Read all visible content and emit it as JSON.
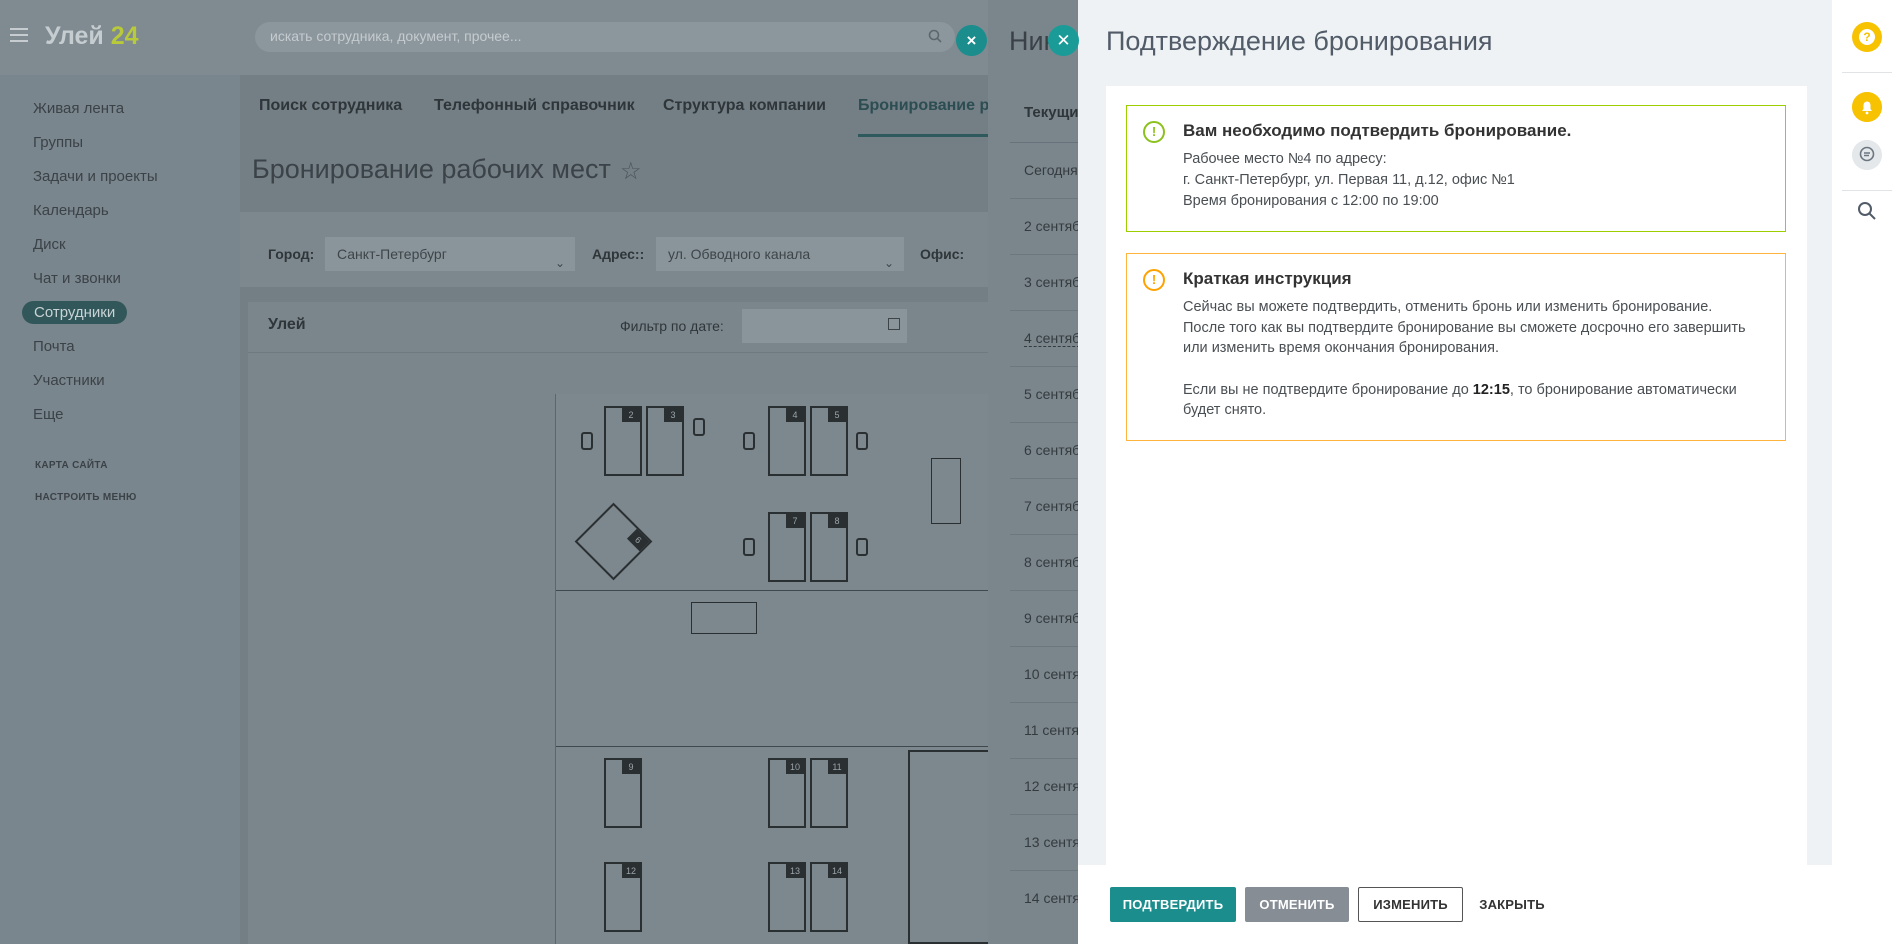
{
  "app": {
    "logo_text": "Улей",
    "logo_num": "24"
  },
  "search": {
    "placeholder": "искать сотрудника, документ, прочее..."
  },
  "sidebar": {
    "items": [
      {
        "label": "Живая лента"
      },
      {
        "label": "Группы"
      },
      {
        "label": "Задачи и проекты"
      },
      {
        "label": "Календарь"
      },
      {
        "label": "Диск"
      },
      {
        "label": "Чат и звонки"
      },
      {
        "label": "Сотрудники"
      },
      {
        "label": "Почта"
      },
      {
        "label": "Участники"
      },
      {
        "label": "Еще"
      }
    ],
    "active": "Сотрудники",
    "small_links": [
      "КАРТА САЙТА",
      "НАСТРОИТЬ МЕНЮ"
    ]
  },
  "main": {
    "tabs": [
      "Поиск сотрудника",
      "Телефонный справочник",
      "Структура компании",
      "Бронирование ра"
    ],
    "page_title": "Бронирование рабочих мест",
    "filters": {
      "city_label": "Город:",
      "city_value": "Санкт-Петербург",
      "address_label": "Адрес::",
      "address_value": "ул. Обводного канала",
      "office_label": "Офис:"
    },
    "card_title": "Улей",
    "date_filter_label": "Фильтр по дате:",
    "seat_numbers": [
      "2",
      "3",
      "4",
      "5",
      "6",
      "7",
      "8",
      "9",
      "10",
      "11",
      "12",
      "13",
      "14"
    ]
  },
  "side_panel": {
    "title": "Ник",
    "tab": "Текущи",
    "dates": [
      "Сегодня",
      "2 сентяб",
      "3 сентяб",
      "4 сентяб",
      "5 сентяб",
      "6 сентяб",
      "7 сентяб",
      "8 сентяб",
      "9 сентяб",
      "10 сентя",
      "11 сентя",
      "12 сентя",
      "13 сентя",
      "14 сентя"
    ]
  },
  "modal": {
    "title": "Подтверждение бронирования",
    "alert_confirm": {
      "title": "Вам необходимо подтвердить бронирование.",
      "line1": "Рабочее место №4 по адресу:",
      "line2": "г. Санкт-Петербург, ул. Первая 11, д.12, офис №1",
      "line3": "Время бронирования с 12:00 по 19:00"
    },
    "alert_instructions": {
      "title": "Краткая инструкция",
      "line1": "Сейчас вы можете подтвердить, отменить бронь или изменить бронирование.",
      "line2": "После того как вы подтвердите бронирование вы сможете досрочно его завершить",
      "line3": "или изменить время окончания бронирования.",
      "line4_pre": "Если вы не подтвердите бронирование до ",
      "line4_time": "12:15",
      "line4_post": ", то бронирование автоматически",
      "line5": "будет снято."
    },
    "buttons": {
      "confirm": "ПОДТВЕРДИТЬ",
      "cancel": "ОТМЕНИТЬ",
      "change": "ИЗМЕНИТЬ",
      "close": "ЗАКРЫТЬ"
    }
  },
  "icons": {
    "alert_confirm": "exclamation-circle-icon",
    "alert_instructions": "exclamation-circle-icon",
    "help": "question-icon",
    "notifications": "bell-icon",
    "messages": "chat-icon",
    "rail_search": "search-icon"
  },
  "colors": {
    "accent": "#1b8d8c",
    "success_border": "#9dcf00",
    "warning_border": "#ffb53d",
    "rail_badge": "#f7c200"
  }
}
